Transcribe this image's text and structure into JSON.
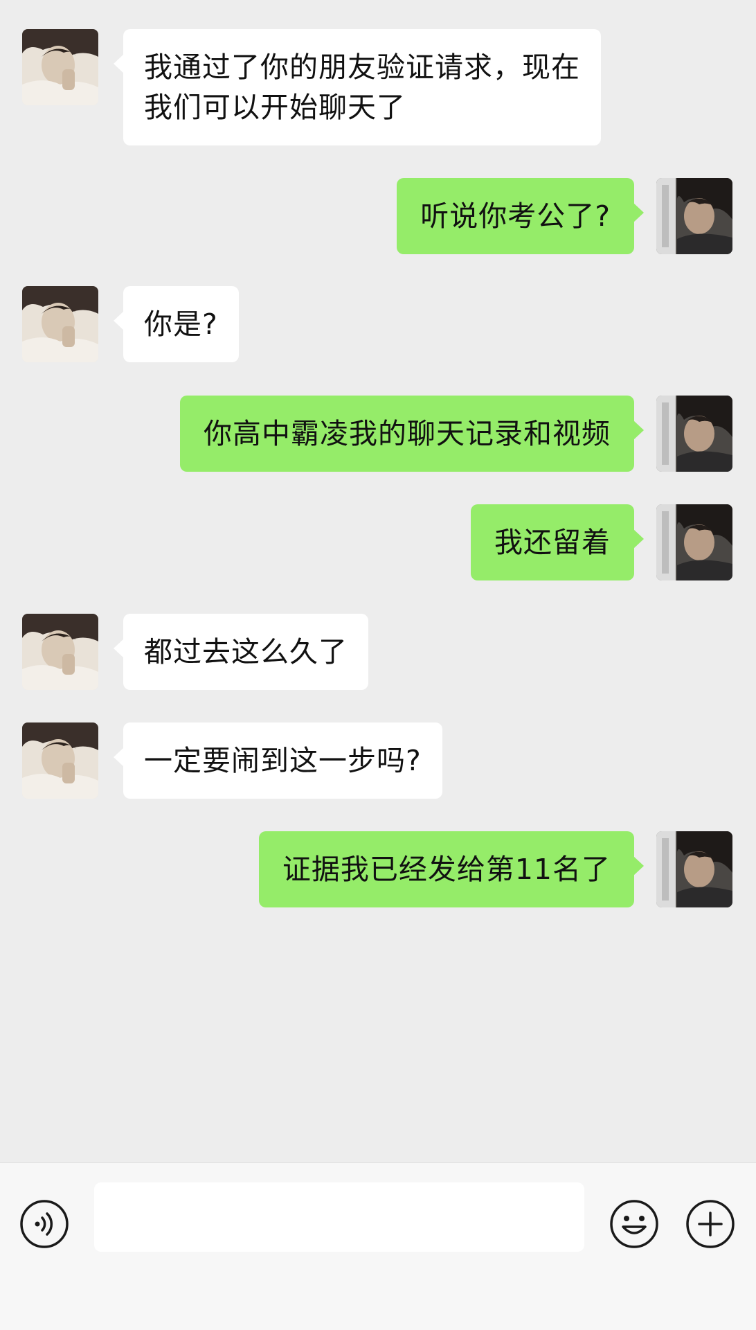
{
  "messages": [
    {
      "side": "left",
      "lines": [
        "我通过了你的朋友验证请求，现在",
        "我们可以开始聊天了"
      ]
    },
    {
      "side": "right",
      "lines": [
        "听说你考公了?"
      ]
    },
    {
      "side": "left",
      "lines": [
        "你是?"
      ]
    },
    {
      "side": "right",
      "lines": [
        "你高中霸凌我的聊天记录和视频"
      ]
    },
    {
      "side": "right",
      "lines": [
        "我还留着"
      ]
    },
    {
      "side": "left",
      "lines": [
        "都过去这么久了"
      ]
    },
    {
      "side": "left",
      "lines": [
        "一定要闹到这一步吗?"
      ]
    },
    {
      "side": "right",
      "lines": [
        "证据我已经发给第11名了"
      ]
    }
  ],
  "input_bar": {
    "text_value": "",
    "voice_icon": "voice-icon",
    "emoji_icon": "emoji-icon",
    "plus_icon": "plus-icon"
  },
  "colors": {
    "background": "#ededed",
    "own_bubble": "#95ec69",
    "other_bubble": "#ffffff",
    "input_bar": "#f7f7f7"
  }
}
